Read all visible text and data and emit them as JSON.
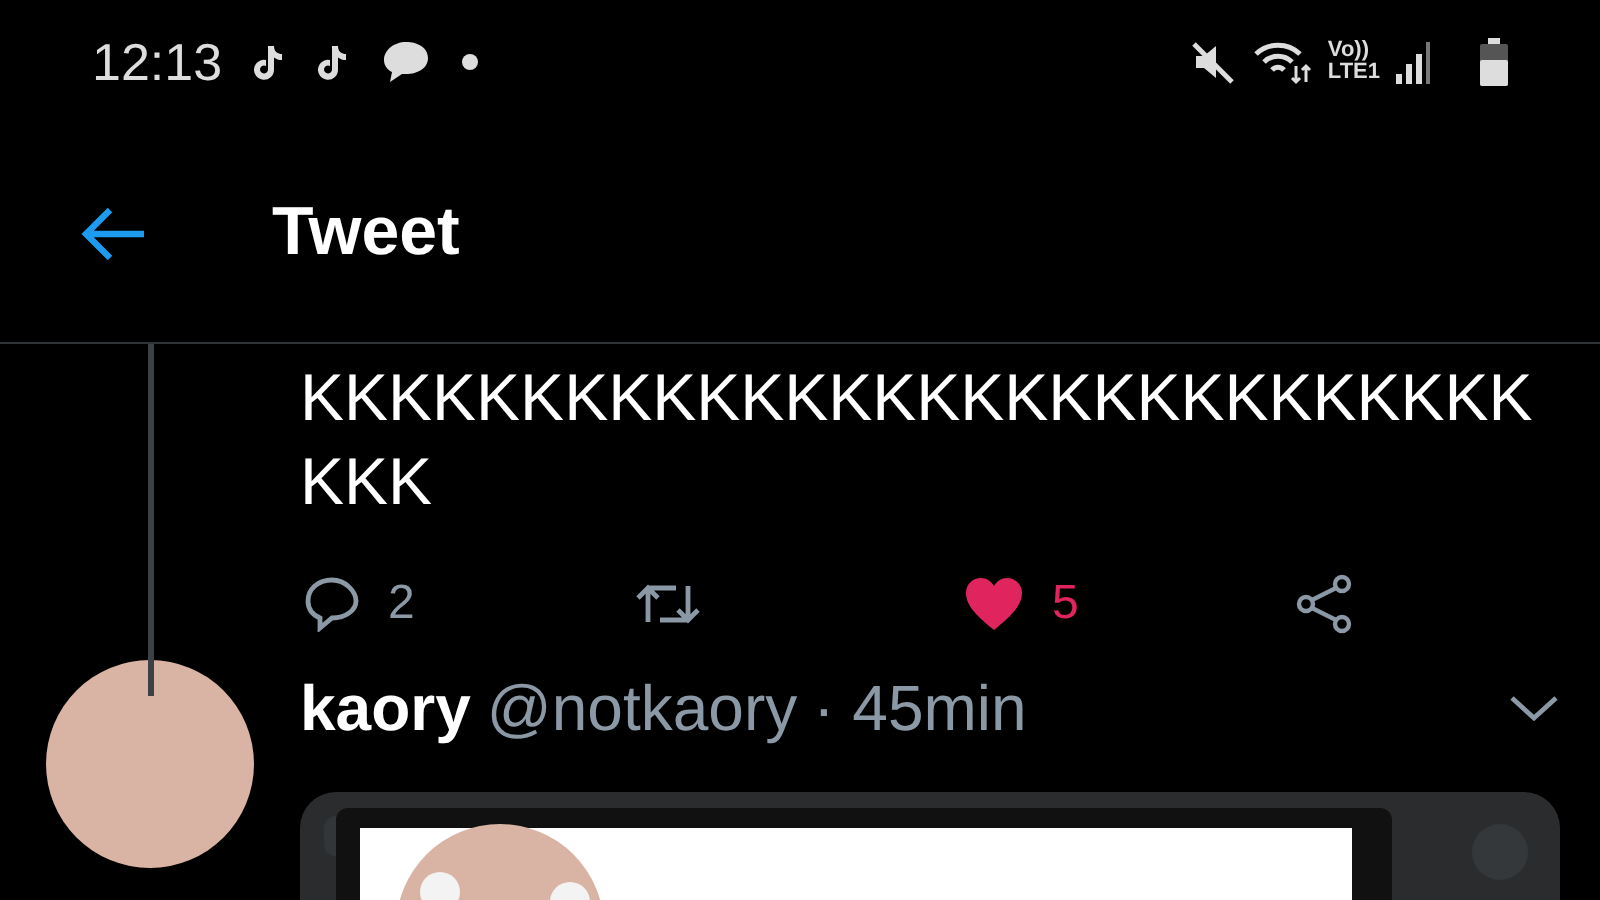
{
  "status_bar": {
    "time": "12:13",
    "network": "Vo))",
    "network_type": "LTE1"
  },
  "header": {
    "title": "Tweet"
  },
  "tweet": {
    "text": "KKKKKKKKKKKKKKKKKKKKKKKKKKKKKKK",
    "replies": "2",
    "likes": "5",
    "liked": true
  },
  "reply": {
    "name": "kaory",
    "handle": "@notkaory",
    "time": "· 45min"
  }
}
